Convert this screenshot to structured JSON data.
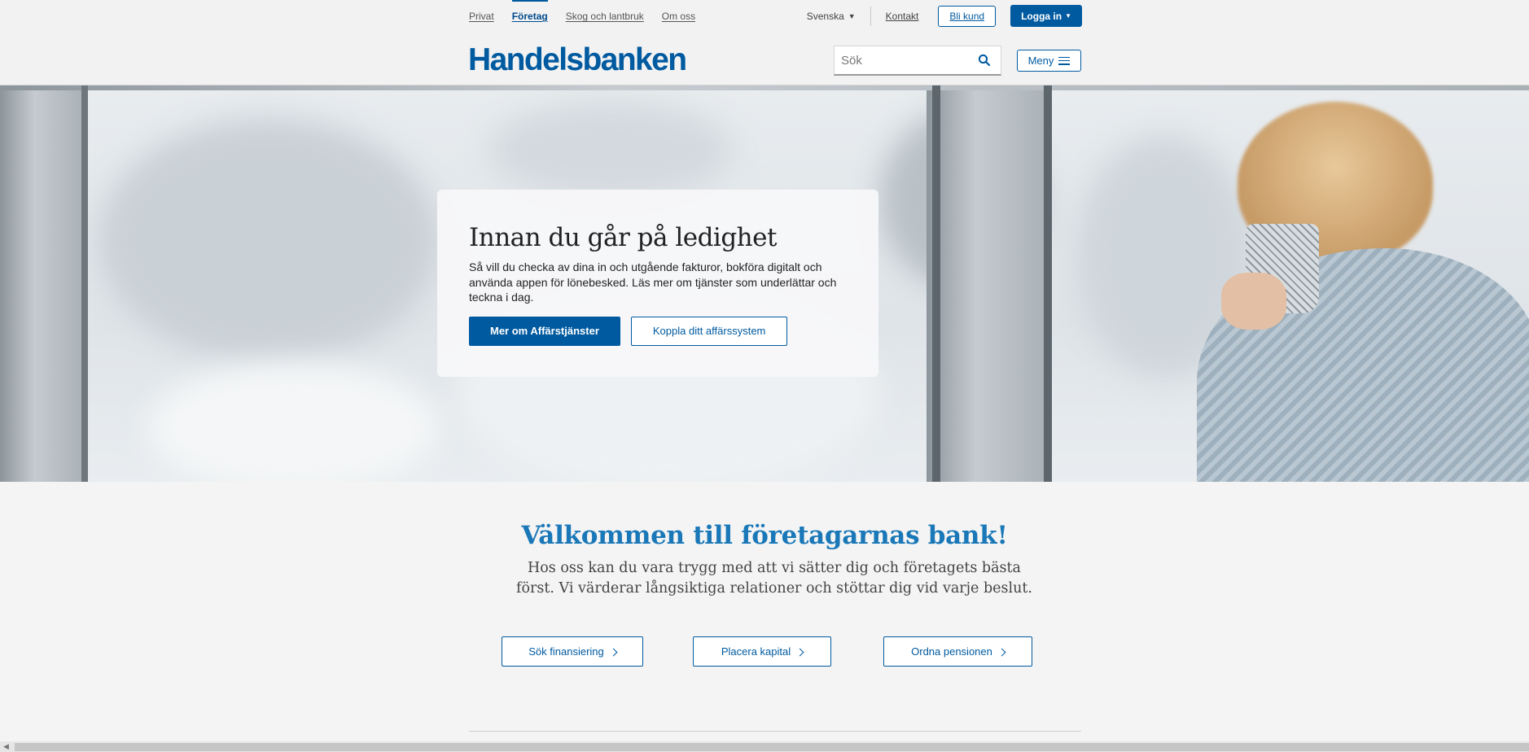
{
  "header": {
    "tabs": [
      {
        "label": "Privat",
        "active": false
      },
      {
        "label": "Företag",
        "active": true
      },
      {
        "label": "Skog och lantbruk",
        "active": false
      },
      {
        "label": "Om oss",
        "active": false
      }
    ],
    "language": "Svenska",
    "contact_label": "Kontakt",
    "become_customer_label": "Bli kund",
    "login_label": "Logga in",
    "logo_text": "Handelsbanken",
    "search_placeholder": "Sök",
    "menu_label": "Meny"
  },
  "hero": {
    "title": "Innan du går på ledighet",
    "text": "Så vill du checka av dina in och utgående fakturor, bokföra digitalt och använda appen för lönebesked. Läs mer om tjänster som underlättar och teckna i dag.",
    "primary_button": "Mer om Affärstjänster",
    "secondary_button": "Koppla ditt affärssystem"
  },
  "welcome": {
    "title": "Välkommen till företagarnas bank!",
    "text": "Hos oss kan du vara trygg med att vi sätter dig och företagets bästa först. Vi värderar långsiktiga relationer och stöttar dig vid varje beslut."
  },
  "actions": [
    {
      "label": "Sök finansiering"
    },
    {
      "label": "Placera kapital"
    },
    {
      "label": "Ordna pensionen"
    }
  ],
  "colors": {
    "brand_blue": "#005aa0",
    "welcome_blue": "#1a78b8",
    "background": "#f4f4f4"
  }
}
